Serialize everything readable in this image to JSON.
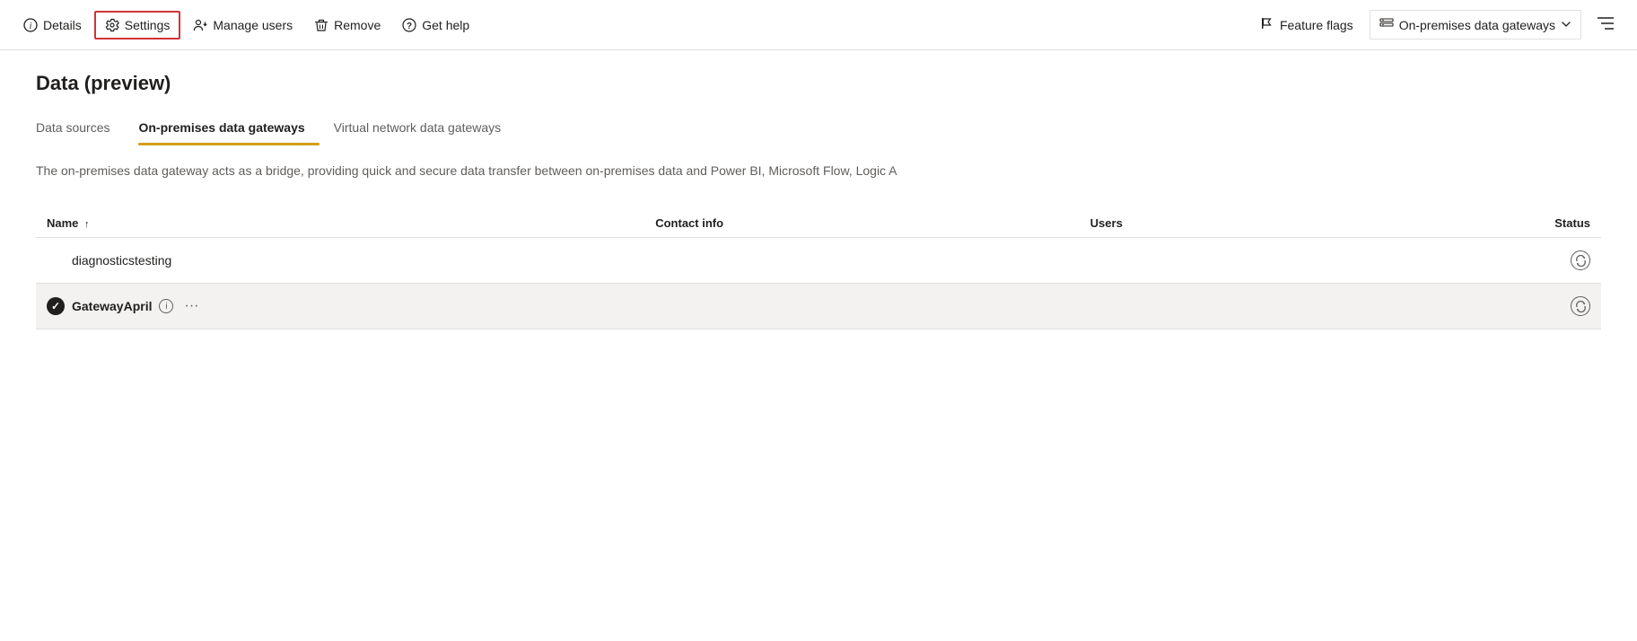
{
  "toolbar": {
    "details_label": "Details",
    "settings_label": "Settings",
    "manage_users_label": "Manage users",
    "remove_label": "Remove",
    "get_help_label": "Get help",
    "feature_flags_label": "Feature flags",
    "gateway_dropdown_label": "On-premises data gateways",
    "settings_active": true
  },
  "page": {
    "title": "Data (preview)"
  },
  "tabs": [
    {
      "id": "data-sources",
      "label": "Data sources",
      "active": false
    },
    {
      "id": "on-premises",
      "label": "On-premises data gateways",
      "active": true
    },
    {
      "id": "virtual-network",
      "label": "Virtual network data gateways",
      "active": false
    }
  ],
  "description": "The on-premises data gateway acts as a bridge, providing quick and secure data transfer between on-premises data and Power BI, Microsoft Flow, Logic A",
  "table": {
    "columns": [
      {
        "id": "name",
        "label": "Name",
        "sort": "asc"
      },
      {
        "id": "contact",
        "label": "Contact info"
      },
      {
        "id": "users",
        "label": "Users"
      },
      {
        "id": "status",
        "label": "Status"
      }
    ],
    "rows": [
      {
        "id": "row1",
        "selected": false,
        "name": "diagnosticstesting",
        "contact": "",
        "users": "",
        "status": "refresh"
      },
      {
        "id": "row2",
        "selected": true,
        "name": "GatewayApril",
        "contact": "",
        "users": "",
        "status": "refresh"
      }
    ]
  }
}
